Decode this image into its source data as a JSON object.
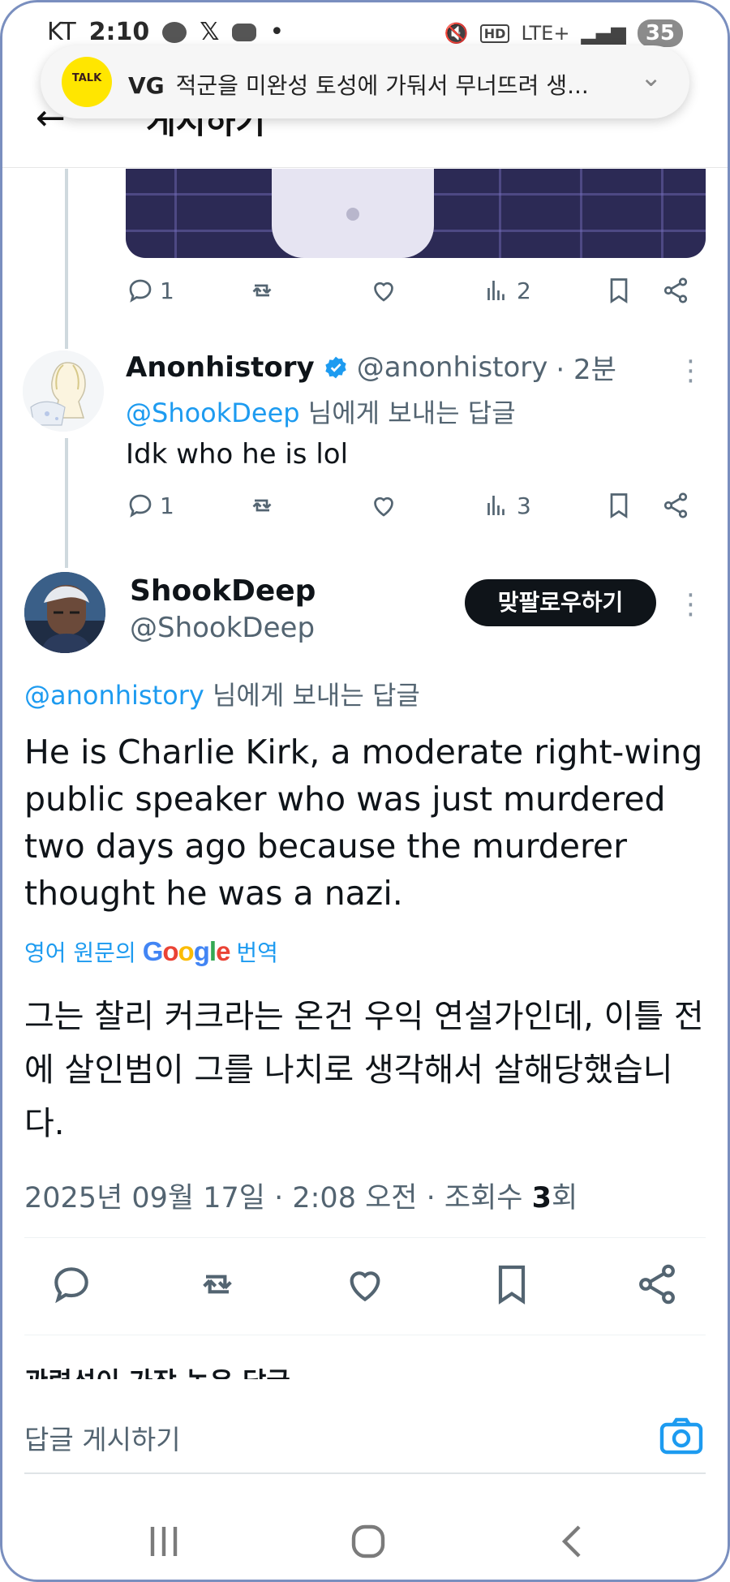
{
  "status_bar": {
    "carrier": "KT",
    "time": "2:10",
    "network": "LTE+",
    "battery": "35"
  },
  "header": {
    "title": "게시하기"
  },
  "notification": {
    "app_icon_label": "TALK",
    "sender": "VG",
    "message": "적군을 미완성 토성에 가둬서 무너뜨려 생..."
  },
  "previous_tweet_actions": {
    "replies": "1",
    "views": "2"
  },
  "reply_tweet": {
    "name": "Anonhistory",
    "handle": "@anonhistory",
    "time": "· 2분",
    "reply_to_mention": "@ShookDeep",
    "reply_to_suffix": "님에게 보내는 답글",
    "text": "Idk who he is lol",
    "replies": "1",
    "views": "3"
  },
  "main_tweet": {
    "name": "ShookDeep",
    "handle": "@ShookDeep",
    "follow_button": "맞팔로우하기",
    "reply_to_mention": "@anonhistory",
    "reply_to_suffix": "님에게 보내는 답글",
    "text": "He is Charlie Kirk, a moderate right-wing public speaker who was just murdered two days ago because the murderer thought he was a nazi.",
    "translate_prefix": "영어 원문의",
    "translate_brand": "Google",
    "translate_suffix": "번역",
    "translated_text": "그는 찰리 커크라는 온건 우익 연설가인데, 이틀 전에 살인범이 그를 나치로 생각해서 살해당했습니다.",
    "date": "2025년 09월 17일 · 2:08 오전 · 조회수",
    "view_count": "3",
    "view_unit": "회"
  },
  "related_label": "관련성이 가장 높은 답글",
  "reply_input": {
    "placeholder": "답글 게시하기"
  },
  "colors": {
    "accent": "#1d9bf0",
    "text_secondary": "#536471",
    "follow_bg": "#0f1419"
  }
}
